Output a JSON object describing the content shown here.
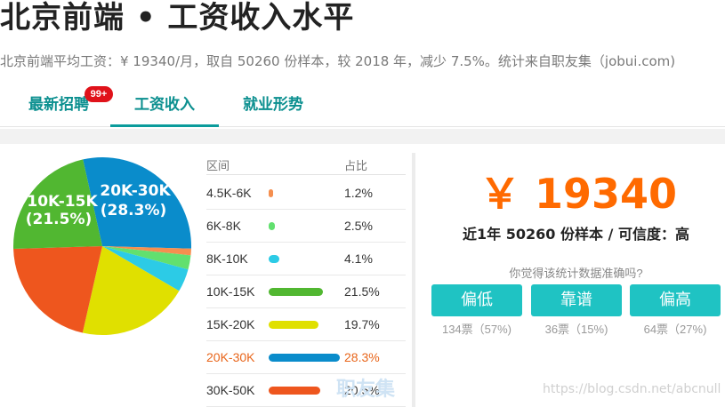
{
  "page": {
    "title": "北京前端 • 工资收入水平",
    "subtitle": "北京前端平均工资：¥ 19340/月，取自 50260 份样本，较 2018 年，减少 7.5%。统计来自职友集（jobui.com)"
  },
  "tabs": [
    {
      "label": "最新招聘"
    },
    {
      "label": "工资收入"
    },
    {
      "label": "就业形势"
    }
  ],
  "badge": "99+",
  "table": {
    "header_range": "区间",
    "header_pct": "占比"
  },
  "pie_labels": {
    "left": {
      "range": "10K-15K",
      "pct": "(21.5%)"
    },
    "right": {
      "range": "20K-30K",
      "pct": "(28.3%)"
    }
  },
  "chart_data": {
    "type": "pie",
    "title": "",
    "categories": [
      "4.5K-6K",
      "6K-8K",
      "8K-10K",
      "10K-15K",
      "15K-20K",
      "20K-30K",
      "30K-50K"
    ],
    "values": [
      1.2,
      2.5,
      4.1,
      21.5,
      19.7,
      28.3,
      20.5
    ],
    "pct_labels": [
      "1.2%",
      "2.5%",
      "4.1%",
      "21.5%",
      "19.7%",
      "28.3%",
      "20.5%"
    ],
    "colors": [
      "#f58f4f",
      "#62e06f",
      "#2ccbe6",
      "#51b731",
      "#e0e000",
      "#0a8ccb",
      "#ee561e"
    ],
    "highlight_index": 5
  },
  "summary": {
    "salary": "￥ 19340",
    "sample_text": "近1年 50260 份样本 / 可信度：高",
    "question": "你觉得该统计数据准确吗?"
  },
  "votes": [
    {
      "label": "偏低",
      "count": "134票（57%)"
    },
    {
      "label": "靠谱",
      "count": "36票（15%)"
    },
    {
      "label": "偏高",
      "count": "64票（27%)"
    }
  ],
  "watermark": {
    "logo": "职友集",
    "url": "https://blog.csdn.net/abcnull"
  },
  "colors": {
    "accent": "#0b8f8f",
    "salary": "#ff6a00",
    "button": "#1fc3c3",
    "badge": "#e0121a"
  }
}
